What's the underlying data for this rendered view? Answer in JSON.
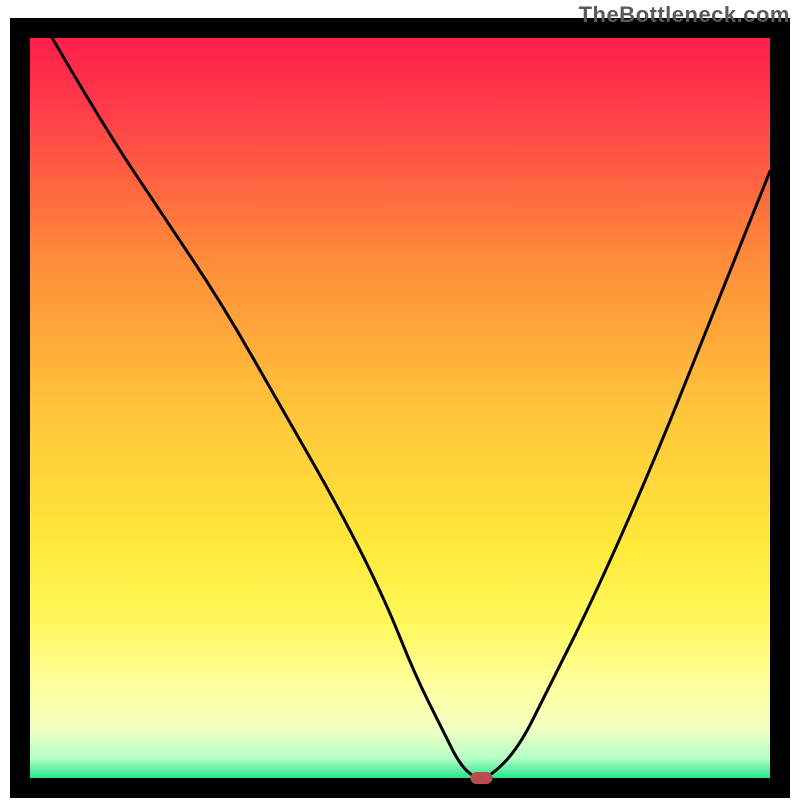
{
  "watermark": "TheBottleneck.com",
  "chart_data": {
    "type": "line",
    "title": "",
    "xlabel": "",
    "ylabel": "",
    "xlim": [
      0,
      100
    ],
    "ylim": [
      0,
      100
    ],
    "series": [
      {
        "name": "bottleneck-curve",
        "x": [
          3,
          10,
          18,
          26,
          34,
          42,
          48,
          52,
          56,
          58,
          60,
          62,
          66,
          70,
          76,
          84,
          92,
          100
        ],
        "values": [
          100,
          88,
          76,
          64,
          50,
          36,
          24,
          14,
          6,
          2,
          0,
          0,
          4,
          12,
          24,
          42,
          62,
          82
        ]
      }
    ],
    "marker": {
      "x": 61,
      "y": 0,
      "color": "#b94c4c"
    },
    "background": {
      "border_color": "#000000",
      "gradient_stops": [
        {
          "offset": 0.0,
          "color": "#ff1a4a"
        },
        {
          "offset": 0.1,
          "color": "#ff3a4a"
        },
        {
          "offset": 0.3,
          "color": "#ff8a3a"
        },
        {
          "offset": 0.5,
          "color": "#ffc43a"
        },
        {
          "offset": 0.68,
          "color": "#ffe93a"
        },
        {
          "offset": 0.78,
          "color": "#fff85a"
        },
        {
          "offset": 0.86,
          "color": "#ffff9a"
        },
        {
          "offset": 0.92,
          "color": "#f4ffc0"
        },
        {
          "offset": 0.96,
          "color": "#b8ffc8"
        },
        {
          "offset": 0.985,
          "color": "#30e890"
        },
        {
          "offset": 1.0,
          "color": "#00d47a"
        }
      ]
    }
  }
}
